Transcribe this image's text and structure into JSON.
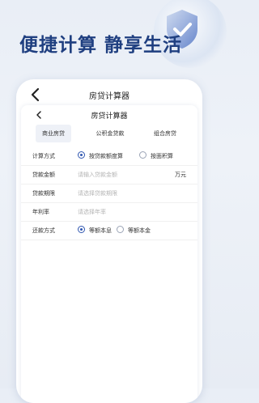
{
  "headline": "便捷计算 静享生活",
  "accent": "#1f3f80",
  "nav": {
    "title": "房贷计算器"
  },
  "sub_nav": {
    "title": "房贷计算器"
  },
  "tabs": [
    {
      "label": "商业房贷",
      "active": true
    },
    {
      "label": "公积金贷款",
      "active": false
    },
    {
      "label": "组合房贷",
      "active": false
    }
  ],
  "form": {
    "calc_method": {
      "label": "计算方式",
      "options": [
        "按贷款额度算",
        "按面积算"
      ],
      "selected": "按贷款额度算"
    },
    "loan_amount": {
      "label": "贷款金额",
      "placeholder": "请输入贷款金额",
      "unit": "万元"
    },
    "loan_term": {
      "label": "贷款期限",
      "placeholder": "请选择贷款期限"
    },
    "rate": {
      "label": "年利率",
      "placeholder": "请选择年率"
    },
    "repay_method": {
      "label": "还款方式",
      "options": [
        "等额本息",
        "等额本金"
      ],
      "selected": "等额本息"
    }
  }
}
